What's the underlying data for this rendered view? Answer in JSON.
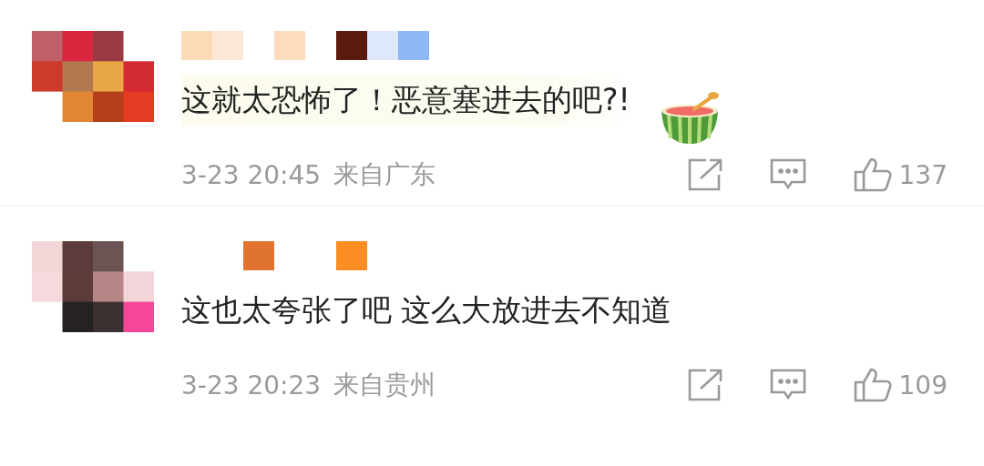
{
  "comments": [
    {
      "text": "这就太恐怖了！恶意塞进去的吧?!",
      "sticker": true,
      "time": "3-23 20:45",
      "location": "来自广东",
      "likes": "137"
    },
    {
      "text": "这也太夸张了吧 这么大放进去不知道",
      "sticker": false,
      "time": "3-23 20:23",
      "location": "来自贵州",
      "likes": "109"
    }
  ]
}
